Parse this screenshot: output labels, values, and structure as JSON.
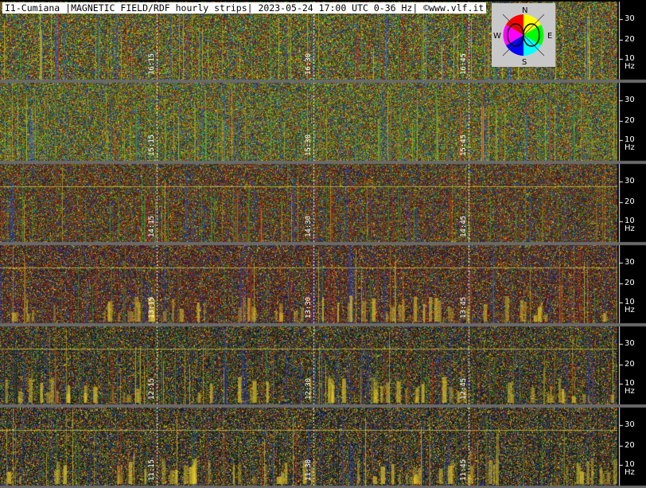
{
  "title": "I1-Cumiana |MAGNETIC FIELD/RDF hourly strips| 2023-05-24 17:00 UTC 0-36 Hz| ©www.vlf.it",
  "compass": {
    "north": "N",
    "south": "S",
    "east": "E",
    "west": "W"
  },
  "axis": {
    "ticks": [
      "30",
      "20",
      "10 Hz"
    ]
  },
  "strips": [
    {
      "times": [
        "16:15",
        "16:30",
        "16:45"
      ]
    },
    {
      "times": [
        "15:15",
        "15:30",
        "15:45"
      ]
    },
    {
      "times": [
        "14:15",
        "14:30",
        "14:45"
      ]
    },
    {
      "times": [
        "13:15",
        "13:30",
        "13:45"
      ]
    },
    {
      "times": [
        "12:15",
        "12:30",
        "12:45"
      ]
    },
    {
      "times": [
        "11:15",
        "11:30",
        "11:45"
      ]
    }
  ],
  "colors": {
    "background": "#000000",
    "title_bg": "#ffffff",
    "compass_bg": "#c8c8c8",
    "separator": "#6a6a6a"
  }
}
